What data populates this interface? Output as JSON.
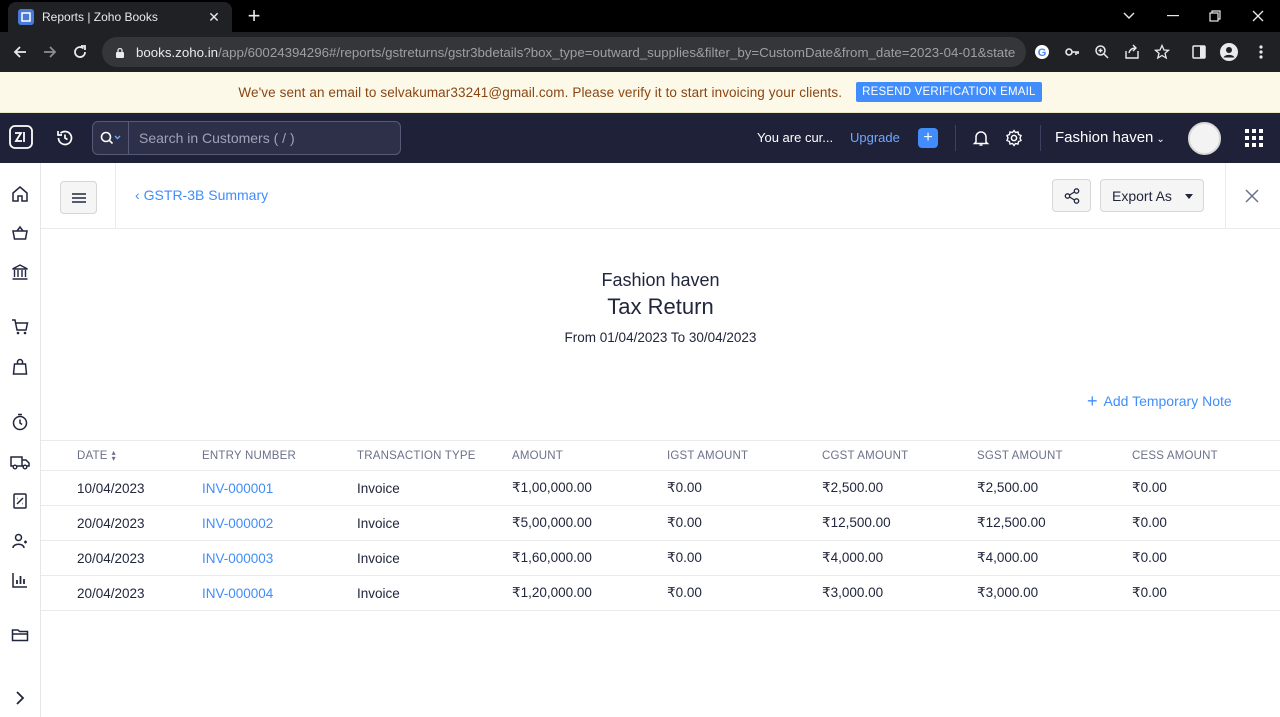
{
  "browser": {
    "tab_title": "Reports | Zoho Books",
    "url_host": "books.zoho.in",
    "url_path": "/app/60024394296#/reports/gstreturns/gstr3bdetails?box_type=outward_supplies&filter_by=CustomDate&from_date=2023-04-01&state..."
  },
  "banner": {
    "message": "We've sent an email to selvakumar33241@gmail.com. Please verify it to start invoicing your clients.",
    "resend_label": "RESEND VERIFICATION EMAIL"
  },
  "header": {
    "search_placeholder": "Search in Customers ( / )",
    "trial_text": "You are cur...",
    "upgrade_label": "Upgrade",
    "org_name": "Fashion haven"
  },
  "report_header": {
    "back_label": "GSTR-3B Summary",
    "export_label": "Export As"
  },
  "report": {
    "org_name": "Fashion haven",
    "title": "Tax Return",
    "date_range": "From 01/04/2023 To 30/04/2023",
    "add_note_label": "Add Temporary Note"
  },
  "table": {
    "columns": [
      "DATE",
      "ENTRY NUMBER",
      "TRANSACTION TYPE",
      "AMOUNT",
      "IGST AMOUNT",
      "CGST AMOUNT",
      "SGST AMOUNT",
      "CESS AMOUNT"
    ],
    "rows": [
      {
        "date": "10/04/2023",
        "entry": "INV-000001",
        "type": "Invoice",
        "amount": "₹1,00,000.00",
        "igst": "₹0.00",
        "cgst": "₹2,500.00",
        "sgst": "₹2,500.00",
        "cess": "₹0.00"
      },
      {
        "date": "20/04/2023",
        "entry": "INV-000002",
        "type": "Invoice",
        "amount": "₹5,00,000.00",
        "igst": "₹0.00",
        "cgst": "₹12,500.00",
        "sgst": "₹12,500.00",
        "cess": "₹0.00"
      },
      {
        "date": "20/04/2023",
        "entry": "INV-000003",
        "type": "Invoice",
        "amount": "₹1,60,000.00",
        "igst": "₹0.00",
        "cgst": "₹4,000.00",
        "sgst": "₹4,000.00",
        "cess": "₹0.00"
      },
      {
        "date": "20/04/2023",
        "entry": "INV-000004",
        "type": "Invoice",
        "amount": "₹1,20,000.00",
        "igst": "₹0.00",
        "cgst": "₹3,000.00",
        "sgst": "₹3,000.00",
        "cess": "₹0.00"
      }
    ]
  },
  "colors": {
    "accent": "#408dfb",
    "header_bg": "#1f2138",
    "banner_bg": "#fcf9e8"
  }
}
